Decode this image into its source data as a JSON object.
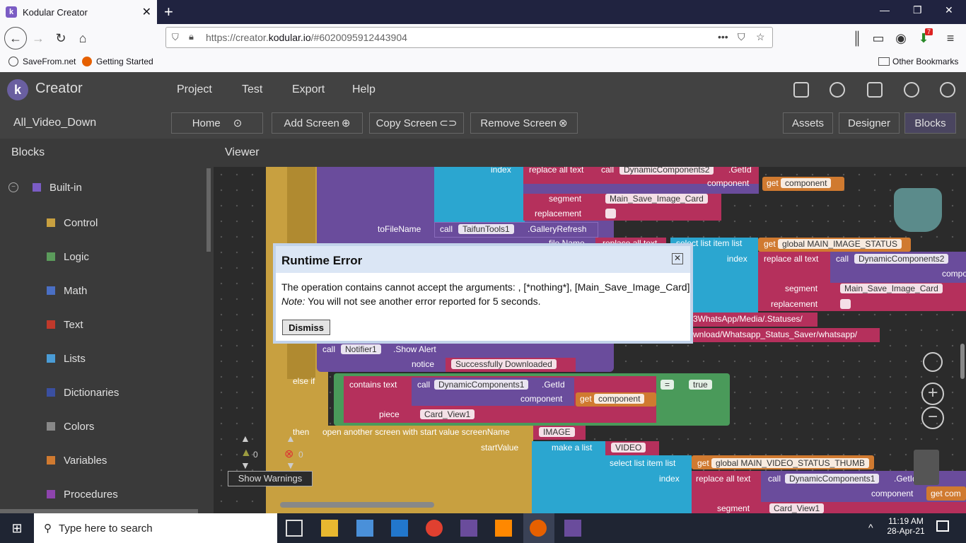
{
  "browser": {
    "tab_title": "Kodular Creator",
    "tab_close": "✕",
    "new_tab": "+",
    "url_prefix": "https://creator.",
    "url_domain": "kodular.io",
    "url_suffix": "/#6020095912443904",
    "bookmarks": [
      "SaveFrom.net",
      "Getting Started"
    ],
    "other_bookmarks": "Other Bookmarks",
    "notif_badge": "7"
  },
  "app": {
    "name": "Creator",
    "logo_letter": "k",
    "menu": [
      "Project",
      "Test",
      "Export",
      "Help"
    ],
    "project_name": "All_Video_Down",
    "screen_buttons": {
      "home": "Home",
      "add": "Add Screen",
      "copy": "Copy Screen",
      "remove": "Remove Screen"
    },
    "view_buttons": {
      "assets": "Assets",
      "designer": "Designer",
      "blocks": "Blocks"
    },
    "blocks_panel_title": "Blocks",
    "viewer_title": "Viewer"
  },
  "sidebar": {
    "group": "Built-in",
    "items": [
      {
        "label": "Control",
        "color": "#c8a040"
      },
      {
        "label": "Logic",
        "color": "#5b9b5b"
      },
      {
        "label": "Math",
        "color": "#4a6fc4"
      },
      {
        "label": "Text",
        "color": "#c0392b"
      },
      {
        "label": "Lists",
        "color": "#4a9cd6"
      },
      {
        "label": "Dictionaries",
        "color": "#3a4fa0"
      },
      {
        "label": "Colors",
        "color": "#888888"
      },
      {
        "label": "Variables",
        "color": "#d07a30"
      },
      {
        "label": "Procedures",
        "color": "#8e44ad"
      }
    ]
  },
  "blocks": {
    "index1": "index",
    "replace_all_text1": "replace all text",
    "call": "call",
    "dyn2": "DynamicComponents2",
    "getid": ".GetId",
    "component": "component",
    "get": "get",
    "component_var": "component",
    "segment": "segment",
    "main_save_image_card": "Main_Save_Image_Card",
    "replacement": "replacement",
    "to_file_name": "toFileName",
    "taifun": "TaifunTools1",
    "gallery_refresh": ".GalleryRefresh",
    "file_name": "file Name",
    "replace_all_text2": "replace all text",
    "select_list_item": "select list item  list",
    "main_image_status": "global MAIN_IMAGE_STATUS",
    "index2": "index",
    "replace_all_text3": "replace all text",
    "dyn2b": "DynamicComponents2",
    "compo": "compo",
    "segment2": "segment",
    "main_save_image_card2": "Main_Save_Image_Card",
    "replacement2": "replacement",
    "whatsapp_path": "3WhatsApp/Media/.Statuses/",
    "download_path": "wnload/Whatsapp_Status_Saver/whatsapp/",
    "notifier": "Notifier1",
    "show_alert": ".Show Alert",
    "notice": "notice",
    "success": "Successfully Downloaded",
    "else_if": "else if",
    "contains_text": "contains  text",
    "dyn1": "DynamicComponents1",
    "getid2": ".GetId",
    "component2": "component",
    "component_var2": "component",
    "equals": "=",
    "true": "true",
    "piece": "piece",
    "card_view1": "Card_View1",
    "then": "then",
    "open_screen": "open another screen with start value  screenName",
    "image": "IMAGE",
    "start_value": "startValue",
    "make_list": "make a list",
    "video": "VIDEO",
    "select_list_item2": "select list item  list",
    "main_video_status_thumb": "global MAIN_VIDEO_STATUS_THUMB",
    "index3": "index",
    "replace_all_text4": "replace all text",
    "dyn1b": "DynamicComponents1",
    "getid3": ".GetId",
    "component3": "component",
    "get_com": "get com",
    "segment3": "segment",
    "card_view1b": "Card_View1",
    "warn_count": "0",
    "error_count": "0",
    "show_warnings": "Show Warnings"
  },
  "dialog": {
    "title": "Runtime Error",
    "close": "✕",
    "message": "The operation contains cannot accept the arguments: , [*nothing*], [Main_Save_Image_Card]",
    "note_label": "Note:",
    "note_text": " You will not see another error reported for 5 seconds.",
    "dismiss": "Dismiss"
  },
  "taskbar": {
    "search_placeholder": "Type here to search",
    "time": "11:19 AM",
    "date": "28-Apr-21"
  }
}
